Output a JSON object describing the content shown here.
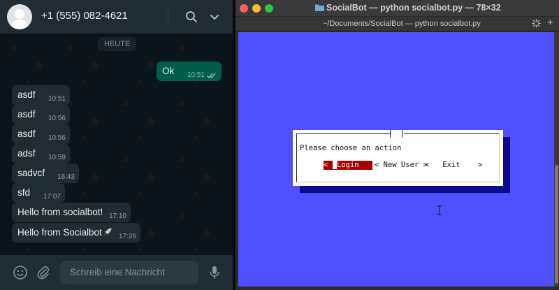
{
  "whatsapp": {
    "contact": "+1 (555) 082-4621",
    "day_chip": "HEUTE",
    "messages": [
      {
        "direction": "out",
        "text": "Ok",
        "time": "10:51",
        "status": "read"
      },
      {
        "direction": "in",
        "text": "asdf",
        "time": "10:51"
      },
      {
        "direction": "in",
        "text": "asdf",
        "time": "10:56"
      },
      {
        "direction": "in",
        "text": "asdf",
        "time": "10:56"
      },
      {
        "direction": "in",
        "text": "adsf",
        "time": "10:59"
      },
      {
        "direction": "in",
        "text": "sadvcf",
        "time": "16:43"
      },
      {
        "direction": "in",
        "text": "sfd",
        "time": "17:07"
      },
      {
        "direction": "in",
        "text": "Hello from socialbot!",
        "time": "17:10"
      },
      {
        "direction": "in",
        "text": "Hello from Socialbot",
        "emoji": "rocket",
        "time": "17:26"
      }
    ],
    "input_placeholder": "Schreib eine Nachricht",
    "icons": [
      "avatar",
      "search-icon",
      "chevron-down-icon",
      "emoji-icon",
      "attach-icon",
      "microphone-icon"
    ],
    "colors": {
      "header": "#202c33",
      "chat_bg": "#0b141a",
      "outgoing": "#005c4b",
      "incoming": "#202c33"
    }
  },
  "terminal": {
    "title": "SocialBot — python socialbot.py — 78×32",
    "tab_label": "~/Documents/SocialBot — python socialbot.py",
    "new_tab_label": "+",
    "dialog": {
      "prompt": "Please choose an action",
      "buttons": [
        {
          "left": "<",
          "label": "Login",
          "right": ">",
          "selected": true
        },
        {
          "left": "<",
          "label": "New User",
          "right": ">",
          "selected": false
        },
        {
          "left": "<",
          "label": "Exit",
          "right": ">",
          "selected": false
        }
      ]
    },
    "colors": {
      "screen": "#4f4ffe",
      "dialog": "#ffffff",
      "dialog_shadow": "#0a0a8a",
      "selected_button": "#a40000"
    }
  }
}
